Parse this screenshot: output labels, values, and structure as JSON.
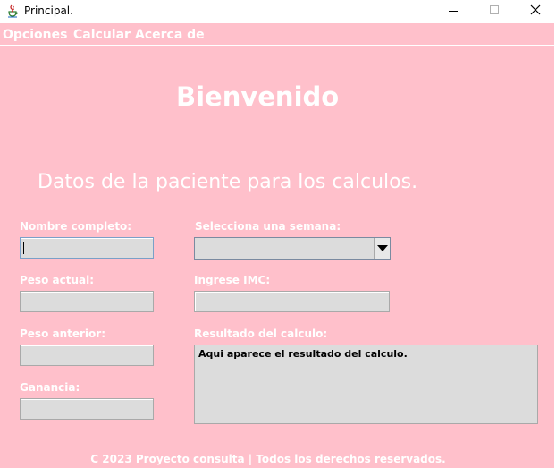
{
  "window": {
    "title": "Principal.",
    "background_color": "#ffc0cb",
    "app_icon": "java-cup-icon"
  },
  "window_controls": {
    "minimize_icon": "minimize-icon",
    "maximize_icon": "maximize-icon",
    "close_icon": "close-icon"
  },
  "menubar": {
    "items": [
      {
        "label": "Opciones"
      },
      {
        "label": "Calcular"
      },
      {
        "label": "Acerca de"
      }
    ]
  },
  "main": {
    "welcome": "Bienvenido",
    "subtitle": "Datos de la paciente para los calculos."
  },
  "form": {
    "nombre_label": "Nombre completo:",
    "nombre_value": "",
    "peso_actual_label": "Peso actual:",
    "peso_actual_value": "",
    "peso_anterior_label": "Peso anterior:",
    "peso_anterior_value": "",
    "ganancia_label": "Ganancia:",
    "ganancia_value": "",
    "semana_label": "Selecciona una semana:",
    "semana_selected": "",
    "imc_label": "Ingrese IMC:",
    "imc_value": "",
    "resultado_label": "Resultado del calculo:",
    "resultado_text": "Aqui aparece el resultado del calculo."
  },
  "footer": {
    "text": "C 2023 Proyecto consulta | Todos los derechos reservados."
  }
}
